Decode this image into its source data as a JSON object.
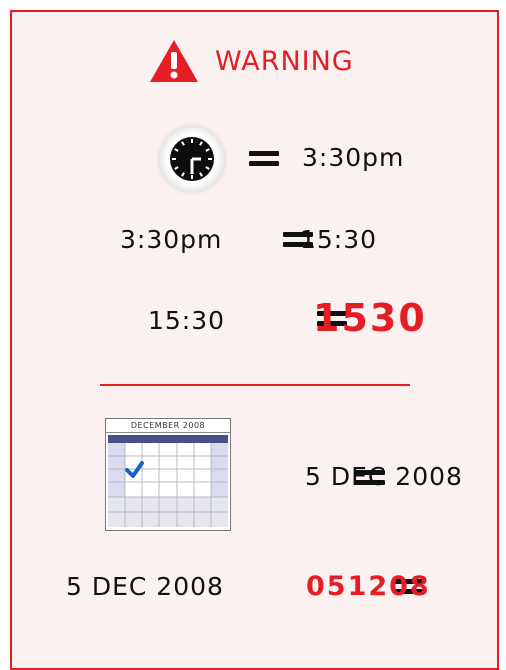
{
  "warning": {
    "label": "WARNING",
    "icon": "warning-triangle-icon",
    "color": "#e51e25"
  },
  "time_rules": [
    {
      "left_icon": "clock-icon",
      "right": "3:30pm"
    },
    {
      "left": "3:30pm",
      "right": "15:30"
    },
    {
      "left": "15:30",
      "right": "1530"
    }
  ],
  "date_rules": [
    {
      "left_icon": "calendar-icon",
      "calendar_title": "DECEMBER 2008",
      "right": "5 DEC 2008"
    },
    {
      "left": "5 DEC 2008",
      "right": "051208"
    }
  ],
  "accent_color": "#e51e25"
}
